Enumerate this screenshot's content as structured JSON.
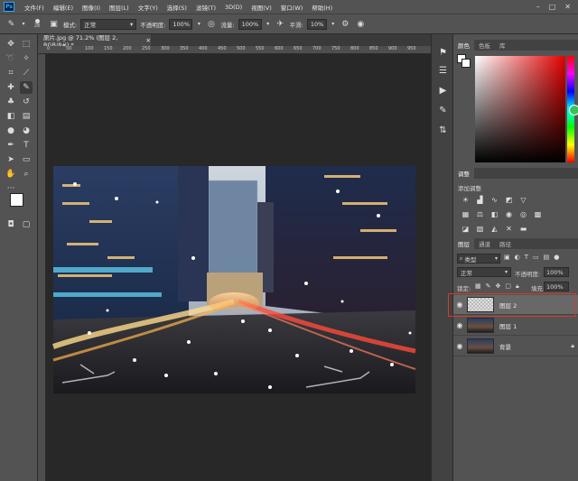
{
  "menu": {
    "items": [
      "文件(F)",
      "编辑(E)",
      "图像(I)",
      "图层(L)",
      "文字(Y)",
      "选择(S)",
      "滤镜(T)",
      "3D(D)",
      "视图(V)",
      "窗口(W)",
      "帮助(H)"
    ],
    "logo": "Ps"
  },
  "options": {
    "brush_size": "28",
    "mode_label": "模式:",
    "mode_value": "正常",
    "opacity_label": "不透明度:",
    "opacity_value": "100%",
    "flow_label": "流量:",
    "flow_value": "100%",
    "smooth_label": "平滑:",
    "smooth_value": "10%"
  },
  "document": {
    "tab_title": "原片.jpg @ 71.2% (图层 2, RGB/8#) *",
    "ruler_ticks": [
      "0",
      "50",
      "100",
      "150",
      "200",
      "250",
      "300",
      "350",
      "400",
      "450",
      "500",
      "550",
      "600",
      "650",
      "700",
      "750",
      "800",
      "850",
      "900",
      "950"
    ]
  },
  "color_panel": {
    "tabs": [
      "颜色",
      "色板",
      "库"
    ]
  },
  "adjust_panel": {
    "tabs": [
      "调整"
    ],
    "subtitle": "添加调整"
  },
  "layers_panel": {
    "tabs": [
      "图层",
      "通道",
      "路径"
    ],
    "filter_value": "类型",
    "blend_mode": "正常",
    "opacity_label": "不透明度:",
    "opacity_value": "100%",
    "lock_label": "锁定:",
    "fill_label": "填充:",
    "fill_value": "100%",
    "layers": [
      {
        "name": "图层 2",
        "selected": true
      },
      {
        "name": "图层 1",
        "selected": false
      },
      {
        "name": "背景",
        "selected": false
      }
    ]
  },
  "colors": {
    "selection_highlight": "#d23a2e",
    "foreground": "#ffffff",
    "background": "#ffffff",
    "hue_base": "#e30000"
  }
}
